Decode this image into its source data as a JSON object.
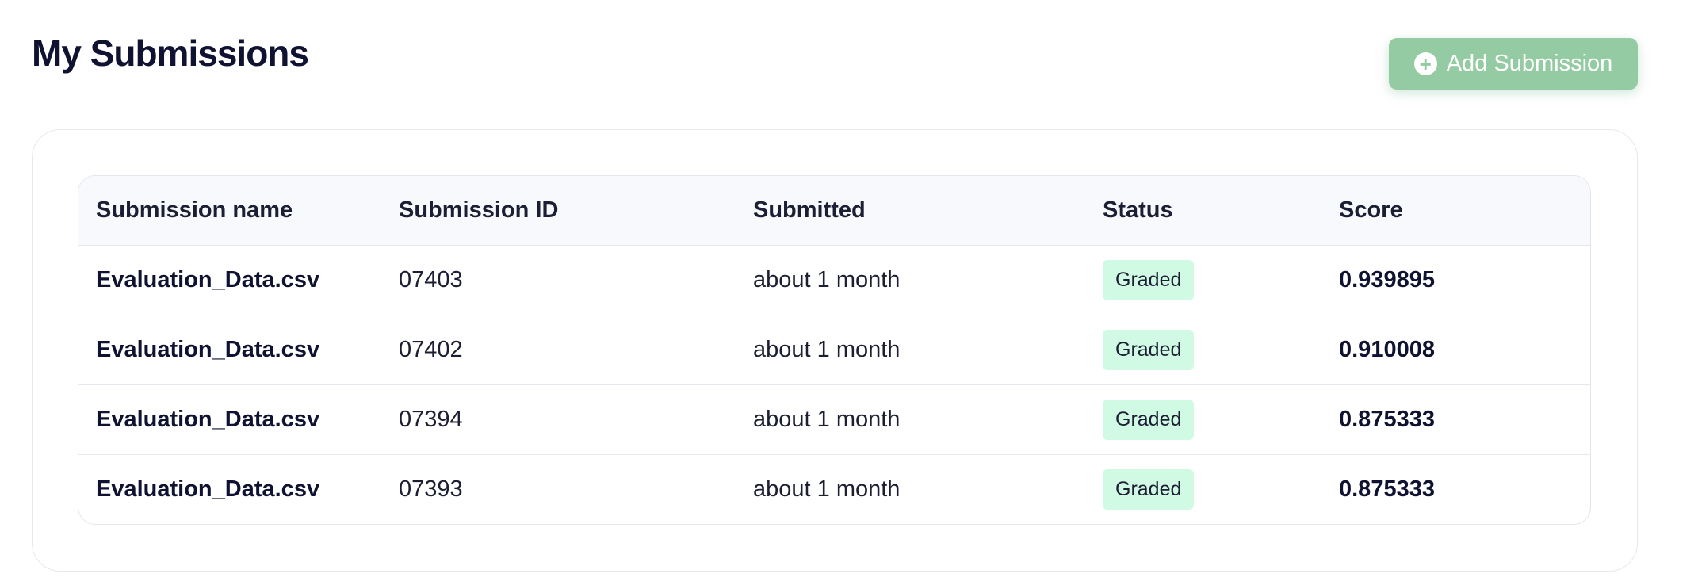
{
  "page": {
    "title": "My Submissions"
  },
  "actions": {
    "add_submission_label": "Add Submission",
    "add_icon": "plus-circle-icon"
  },
  "colors": {
    "accent": "#95cba2",
    "badge_bg": "#d1fae5",
    "title": "#0f1230"
  },
  "table": {
    "headers": [
      "Submission name",
      "Submission ID",
      "Submitted",
      "Status",
      "Score"
    ],
    "rows": [
      {
        "name": "Evaluation_Data.csv",
        "id": "07403",
        "submitted": "about 1 month",
        "status": "Graded",
        "score": "0.939895"
      },
      {
        "name": "Evaluation_Data.csv",
        "id": "07402",
        "submitted": "about 1 month",
        "status": "Graded",
        "score": "0.910008"
      },
      {
        "name": "Evaluation_Data.csv",
        "id": "07394",
        "submitted": "about 1 month",
        "status": "Graded",
        "score": "0.875333"
      },
      {
        "name": "Evaluation_Data.csv",
        "id": "07393",
        "submitted": "about 1 month",
        "status": "Graded",
        "score": "0.875333"
      }
    ]
  }
}
